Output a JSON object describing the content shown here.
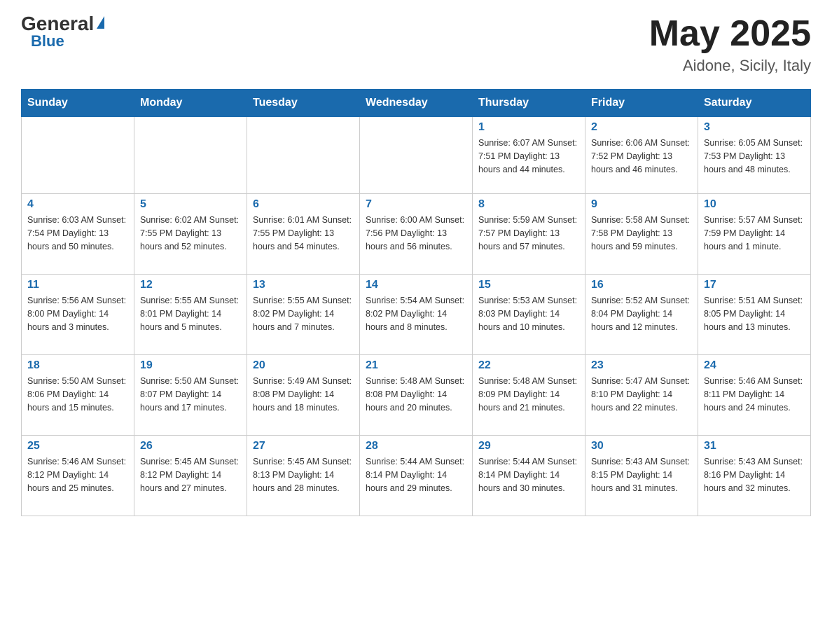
{
  "logo": {
    "general": "General",
    "blue": "Blue"
  },
  "title": {
    "month_year": "May 2025",
    "location": "Aidone, Sicily, Italy"
  },
  "weekdays": [
    "Sunday",
    "Monday",
    "Tuesday",
    "Wednesday",
    "Thursday",
    "Friday",
    "Saturday"
  ],
  "weeks": [
    [
      {
        "day": "",
        "info": ""
      },
      {
        "day": "",
        "info": ""
      },
      {
        "day": "",
        "info": ""
      },
      {
        "day": "",
        "info": ""
      },
      {
        "day": "1",
        "info": "Sunrise: 6:07 AM\nSunset: 7:51 PM\nDaylight: 13 hours\nand 44 minutes."
      },
      {
        "day": "2",
        "info": "Sunrise: 6:06 AM\nSunset: 7:52 PM\nDaylight: 13 hours\nand 46 minutes."
      },
      {
        "day": "3",
        "info": "Sunrise: 6:05 AM\nSunset: 7:53 PM\nDaylight: 13 hours\nand 48 minutes."
      }
    ],
    [
      {
        "day": "4",
        "info": "Sunrise: 6:03 AM\nSunset: 7:54 PM\nDaylight: 13 hours\nand 50 minutes."
      },
      {
        "day": "5",
        "info": "Sunrise: 6:02 AM\nSunset: 7:55 PM\nDaylight: 13 hours\nand 52 minutes."
      },
      {
        "day": "6",
        "info": "Sunrise: 6:01 AM\nSunset: 7:55 PM\nDaylight: 13 hours\nand 54 minutes."
      },
      {
        "day": "7",
        "info": "Sunrise: 6:00 AM\nSunset: 7:56 PM\nDaylight: 13 hours\nand 56 minutes."
      },
      {
        "day": "8",
        "info": "Sunrise: 5:59 AM\nSunset: 7:57 PM\nDaylight: 13 hours\nand 57 minutes."
      },
      {
        "day": "9",
        "info": "Sunrise: 5:58 AM\nSunset: 7:58 PM\nDaylight: 13 hours\nand 59 minutes."
      },
      {
        "day": "10",
        "info": "Sunrise: 5:57 AM\nSunset: 7:59 PM\nDaylight: 14 hours\nand 1 minute."
      }
    ],
    [
      {
        "day": "11",
        "info": "Sunrise: 5:56 AM\nSunset: 8:00 PM\nDaylight: 14 hours\nand 3 minutes."
      },
      {
        "day": "12",
        "info": "Sunrise: 5:55 AM\nSunset: 8:01 PM\nDaylight: 14 hours\nand 5 minutes."
      },
      {
        "day": "13",
        "info": "Sunrise: 5:55 AM\nSunset: 8:02 PM\nDaylight: 14 hours\nand 7 minutes."
      },
      {
        "day": "14",
        "info": "Sunrise: 5:54 AM\nSunset: 8:02 PM\nDaylight: 14 hours\nand 8 minutes."
      },
      {
        "day": "15",
        "info": "Sunrise: 5:53 AM\nSunset: 8:03 PM\nDaylight: 14 hours\nand 10 minutes."
      },
      {
        "day": "16",
        "info": "Sunrise: 5:52 AM\nSunset: 8:04 PM\nDaylight: 14 hours\nand 12 minutes."
      },
      {
        "day": "17",
        "info": "Sunrise: 5:51 AM\nSunset: 8:05 PM\nDaylight: 14 hours\nand 13 minutes."
      }
    ],
    [
      {
        "day": "18",
        "info": "Sunrise: 5:50 AM\nSunset: 8:06 PM\nDaylight: 14 hours\nand 15 minutes."
      },
      {
        "day": "19",
        "info": "Sunrise: 5:50 AM\nSunset: 8:07 PM\nDaylight: 14 hours\nand 17 minutes."
      },
      {
        "day": "20",
        "info": "Sunrise: 5:49 AM\nSunset: 8:08 PM\nDaylight: 14 hours\nand 18 minutes."
      },
      {
        "day": "21",
        "info": "Sunrise: 5:48 AM\nSunset: 8:08 PM\nDaylight: 14 hours\nand 20 minutes."
      },
      {
        "day": "22",
        "info": "Sunrise: 5:48 AM\nSunset: 8:09 PM\nDaylight: 14 hours\nand 21 minutes."
      },
      {
        "day": "23",
        "info": "Sunrise: 5:47 AM\nSunset: 8:10 PM\nDaylight: 14 hours\nand 22 minutes."
      },
      {
        "day": "24",
        "info": "Sunrise: 5:46 AM\nSunset: 8:11 PM\nDaylight: 14 hours\nand 24 minutes."
      }
    ],
    [
      {
        "day": "25",
        "info": "Sunrise: 5:46 AM\nSunset: 8:12 PM\nDaylight: 14 hours\nand 25 minutes."
      },
      {
        "day": "26",
        "info": "Sunrise: 5:45 AM\nSunset: 8:12 PM\nDaylight: 14 hours\nand 27 minutes."
      },
      {
        "day": "27",
        "info": "Sunrise: 5:45 AM\nSunset: 8:13 PM\nDaylight: 14 hours\nand 28 minutes."
      },
      {
        "day": "28",
        "info": "Sunrise: 5:44 AM\nSunset: 8:14 PM\nDaylight: 14 hours\nand 29 minutes."
      },
      {
        "day": "29",
        "info": "Sunrise: 5:44 AM\nSunset: 8:14 PM\nDaylight: 14 hours\nand 30 minutes."
      },
      {
        "day": "30",
        "info": "Sunrise: 5:43 AM\nSunset: 8:15 PM\nDaylight: 14 hours\nand 31 minutes."
      },
      {
        "day": "31",
        "info": "Sunrise: 5:43 AM\nSunset: 8:16 PM\nDaylight: 14 hours\nand 32 minutes."
      }
    ]
  ]
}
